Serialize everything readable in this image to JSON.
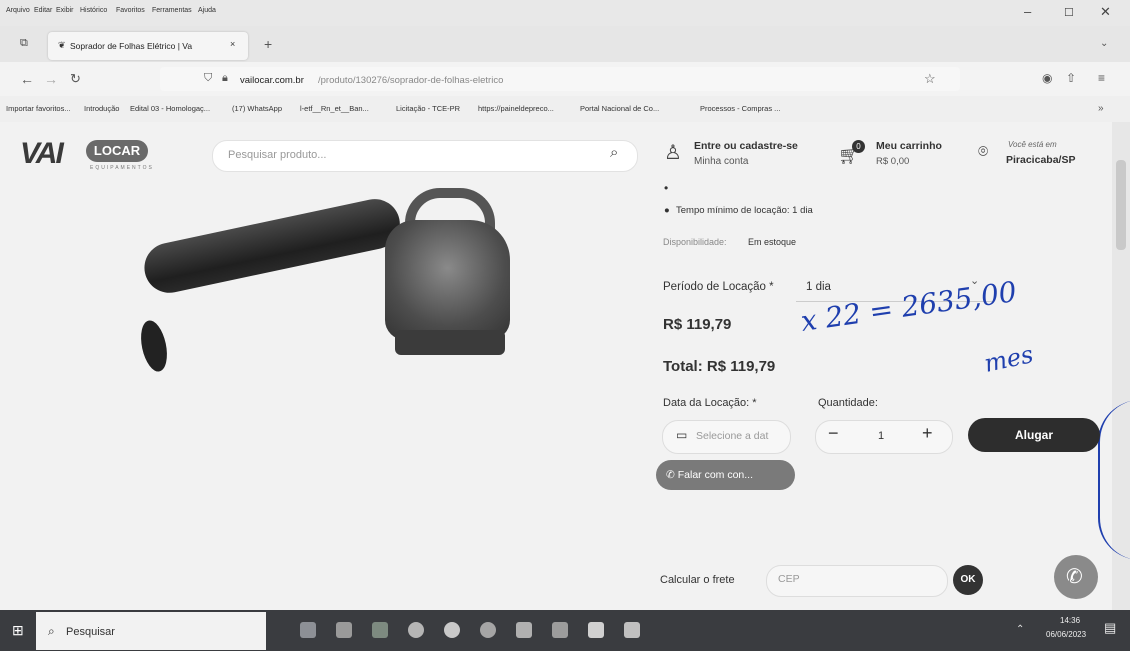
{
  "menu": [
    "Arquivo",
    "Editar",
    "Exibir",
    "Histórico",
    "Favoritos",
    "Ferramentas",
    "Ajuda"
  ],
  "tab": {
    "title": "Soprador de Folhas Elétrico | Va",
    "close": "×",
    "new": "+"
  },
  "url": {
    "domain": "vailocar.com.br",
    "path": "/produto/130276/soprador-de-folhas-eletrico"
  },
  "bookmarks": [
    "Importar favoritos...",
    "Introdução",
    "Edital 03 - Homologaç...",
    "(17) WhatsApp",
    "l-etf__Rn_et__Ban...",
    "Licitação - TCE-PR",
    "https://paineldepreco...",
    "Portal Nacional de Co...",
    "Processos - Compras ..."
  ],
  "site": {
    "logo_main": "VAI",
    "logo_pill": "LOCAR",
    "logo_sub": "EQUIPAMENTOS",
    "search_placeholder": "Pesquisar produto...",
    "account_title": "Entre ou cadastre-se",
    "account_sub": "Minha conta",
    "cart_count": "0",
    "cart_title": "Meu carrinho",
    "cart_value": "R$ 0,00",
    "location_title": "Você está em",
    "location_city": "Piracicaba/SP"
  },
  "product": {
    "min_time": "Tempo mínimo de locação: 1 dia",
    "availability_label": "Disponibilidade:",
    "availability_value": "Em estoque",
    "period_label": "Período de Locação *",
    "period_value": "1 dia",
    "price": "R$ 119,79",
    "total": "Total: R$ 119,79",
    "date_label": "Data da Locação: *",
    "date_placeholder": "Selecione a dat",
    "qty_label": "Quantidade:",
    "qty_value": "1",
    "rent_button": "Alugar",
    "talk_button": "Falar com con...",
    "freight_label": "Calcular o frete",
    "cep_placeholder": "CEP",
    "ok_button": "OK"
  },
  "handwriting": {
    "line1": "x 22 = 2635,00",
    "line2": "mes"
  },
  "taskbar": {
    "search": "Pesquisar",
    "time": "14:36",
    "date": "06/06/2023"
  }
}
